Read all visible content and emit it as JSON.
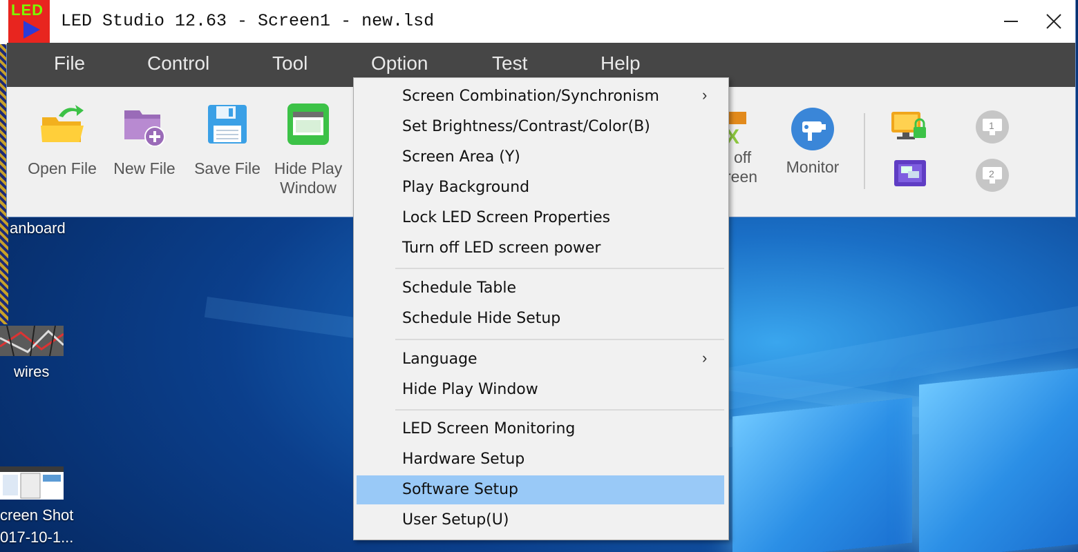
{
  "window": {
    "title": "LED Studio 12.63 - Screen1 - new.lsd",
    "logo_text": "LED",
    "close_glyph": "✕"
  },
  "menubar": [
    {
      "label": "File"
    },
    {
      "label": "Control"
    },
    {
      "label": "Tool"
    },
    {
      "label": "Option"
    },
    {
      "label": "Test"
    },
    {
      "label": "Help"
    }
  ],
  "toolbar": {
    "open_file": {
      "label1": "Open File"
    },
    "new_file": {
      "label1": "New File"
    },
    "save_file": {
      "label1": "Save File"
    },
    "hide_play": {
      "label1": "Hide Play",
      "label2": "Window"
    },
    "turn_off": {
      "label1": "off",
      "label2": "reen"
    },
    "monitor": {
      "label1": "Monitor"
    }
  },
  "option_menu": {
    "items": [
      {
        "label": "Screen Combination/Synchronism",
        "submenu": true
      },
      {
        "label": "Set Brightness/Contrast/Color(B)"
      },
      {
        "label": "Screen Area (Y)"
      },
      {
        "label": "Play Background"
      },
      {
        "label": "Lock LED Screen Properties"
      },
      {
        "label": "Turn off LED screen power"
      },
      {
        "label": "Schedule Table"
      },
      {
        "label": "Schedule Hide Setup"
      },
      {
        "label": "Language",
        "submenu": true
      },
      {
        "label": "Hide Play Window"
      },
      {
        "label": "LED Screen Monitoring"
      },
      {
        "label": "Hardware Setup"
      },
      {
        "label": "Software Setup",
        "highlighted": true
      },
      {
        "label": "User Setup(U)"
      }
    ],
    "submenu_glyph": "›",
    "highlight_color": "#99c9f7"
  },
  "desktop": {
    "icons": [
      {
        "label": "anboard"
      },
      {
        "label": "wires"
      },
      {
        "label1": "creen Shot",
        "label2": "017-10-1..."
      }
    ]
  }
}
